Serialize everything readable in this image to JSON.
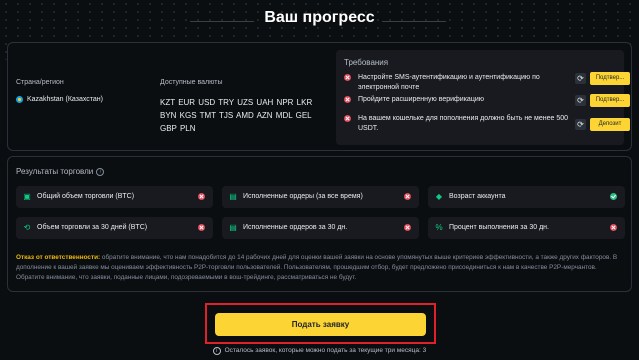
{
  "page": {
    "title": "Ваш прогресс"
  },
  "region": {
    "label": "Страна/регион",
    "value": "Kazakhstan (Казахстан)"
  },
  "currencies": {
    "label": "Доступные валюты",
    "value": "KZT EUR USD TRY UZS UAH NPR LKR BYN KGS TMT TJS AMD AZN MDL GEL GBP PLN"
  },
  "requirements": {
    "title": "Требования",
    "items": [
      {
        "text": "Настройте SMS-аутентификацию и аутентификацию по электронной почте",
        "action": "Подтвер...",
        "status": "x-icon"
      },
      {
        "text": "Пройдите расширенную верификацию",
        "action": "Подтвер...",
        "status": "x-icon"
      },
      {
        "text": "На вашем кошельке для пополнения должно быть не менее 500 USDT.",
        "action": "Депозит",
        "status": "x-icon"
      }
    ]
  },
  "trading": {
    "title": "Результаты торговли",
    "metrics": [
      {
        "label": "Общий объем торговли (BTC)",
        "icon": "wallet-icon",
        "status": "fail"
      },
      {
        "label": "Исполненные ордеры (за все время)",
        "icon": "document-icon",
        "status": "fail"
      },
      {
        "label": "Возраст аккаунта",
        "icon": "diamond-icon",
        "status": "ok"
      },
      {
        "label": "Объем торговли за 30 дней (BTC)",
        "icon": "refresh-icon",
        "status": "fail"
      },
      {
        "label": "Исполненные ордеров за 30 дн.",
        "icon": "document-icon",
        "status": "fail"
      },
      {
        "label": "Процент выполнения за 30 дн.",
        "icon": "percent-icon",
        "status": "fail"
      }
    ],
    "disclaimer_heading": "Отказ от ответственности:",
    "disclaimer_text": " обратите внимание, что нам понадобится до 14 рабочих дней для оценки вашей заявки на основе упомянутых выше критериев эффективности, а также других факторов. В дополнение к вашей заявке мы оцениваем эффективность P2P-торговли пользователей. Пользователям, прошедшим отбор, будет предложено присоединиться к нам в качестве P2P-мерчантов. Обратите внимание, что заявки, поданные лицами, подозреваемыми в вош-трейдинге, рассматриваться не будут."
  },
  "submit": {
    "label": "Подать заявку"
  },
  "remaining": {
    "text": "Осталось заявок, которые можно подать за текущие три месяца: 3"
  },
  "colors": {
    "accent": "#fcd535",
    "fail": "#e04a5a",
    "ok": "#2ebd85",
    "highlight_border": "#e0202a"
  }
}
